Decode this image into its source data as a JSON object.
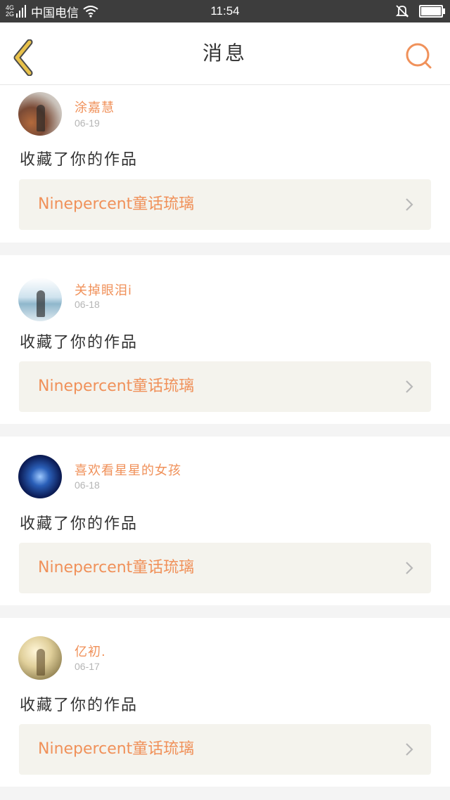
{
  "status_bar": {
    "network_top": "4G",
    "network_bottom": "2G",
    "carrier": "中国电信",
    "time": "11:54"
  },
  "header": {
    "title": "消息",
    "back_icon": "chevron-left-icon",
    "search_icon": "search-icon"
  },
  "colors": {
    "accent": "#f0915a",
    "back_icon": "#e8c14a",
    "work_box_bg": "#f4f3ed"
  },
  "notifications": [
    {
      "user": "涂嘉慧",
      "date": "06-19",
      "action": "收藏了你的作品",
      "work": "Ninepercent童话琉璃"
    },
    {
      "user": "关掉眼泪i",
      "date": "06-18",
      "action": "收藏了你的作品",
      "work": "Ninepercent童话琉璃"
    },
    {
      "user": "喜欢看星星的女孩",
      "date": "06-18",
      "action": "收藏了你的作品",
      "work": "Ninepercent童话琉璃"
    },
    {
      "user": "亿初.",
      "date": "06-17",
      "action": "收藏了你的作品",
      "work": "Ninepercent童话琉璃"
    }
  ]
}
